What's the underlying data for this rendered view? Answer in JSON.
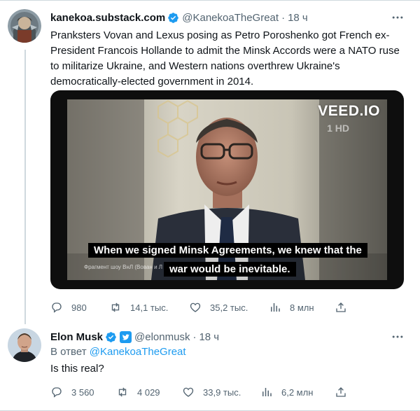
{
  "colors": {
    "accent": "#1d9bf0",
    "secondary_text": "#536471",
    "primary_text": "#0f1419"
  },
  "tweet1": {
    "author_name": "kanekoa.substack.com",
    "handle": "@KanekoaTheGreat",
    "separator": "·",
    "time": "18 ч",
    "text": "Pranksters Vovan and Lexus posing as Petro Poroshenko got French ex-President Francois Hollande to admit the Minsk Accords were a NATO ruse to militarize Ukraine, and Western nations overthrew Ukraine's democratically-elected government in 2014.",
    "media": {
      "watermark": "VEED.IO",
      "channel_logo": "1 HD",
      "subtitle_line1": "When we signed Minsk Agreements, we knew that the",
      "subtitle_line2": "war would be inevitable.",
      "caption": "Фрагмент шоу ВнЛ (Вован и Л"
    },
    "stats": {
      "replies": "980",
      "retweets": "14,1 тыс.",
      "likes": "35,2 тыс.",
      "views": "8 млн"
    }
  },
  "tweet2": {
    "author_name": "Elon Musk",
    "handle": "@elonmusk",
    "separator": "·",
    "time": "18 ч",
    "reply_prefix": "В ответ ",
    "reply_handle": "@KanekoaTheGreat",
    "text": "Is this real?",
    "stats": {
      "replies": "3 560",
      "retweets": "4 029",
      "likes": "33,9 тыс.",
      "views": "6,2 млн"
    }
  }
}
